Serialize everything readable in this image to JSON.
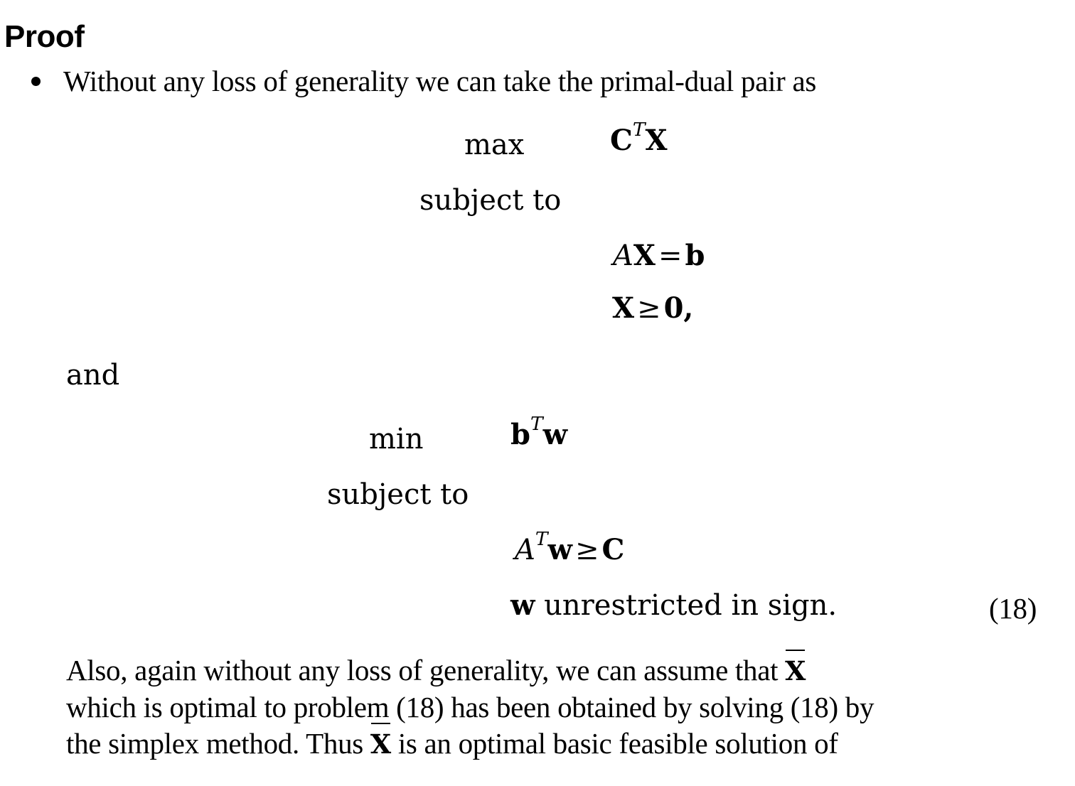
{
  "document": {
    "heading": "Proof",
    "bullet": {
      "marker": "bullet-dot",
      "text": "Without any loss of generality we can take the primal-dual pair as"
    },
    "primal": {
      "objective_op": "max",
      "objective_expr_lead": "C",
      "objective_expr_sup": "T",
      "objective_expr_tail": "X",
      "subject_to": "subject to",
      "constraint_equality": {
        "matrix": "A",
        "variable": "X",
        "relation": "=",
        "rhs": "b"
      },
      "constraint_nonneg": {
        "variable": "X",
        "relation": "≥",
        "rhs": "0",
        "trailing_punctuation": ","
      }
    },
    "connector": "and",
    "dual": {
      "objective_op": "min",
      "objective_expr_lead": "b",
      "objective_expr_sup": "T",
      "objective_expr_tail": "w",
      "subject_to": "subject to",
      "constraint_inequality": {
        "matrix": "A",
        "matrix_sup": "T",
        "variable": "w",
        "relation": "≥",
        "rhs": "C"
      },
      "unrestricted": {
        "variable": "w",
        "text": " unrestricted in sign."
      }
    },
    "equation_number": "(18)",
    "closing_paragraph": {
      "line1_pre": "Also, again without any loss of generality, we can assume that ",
      "line1_xbar": "X̄",
      "line2": "which is optimal to problem (18) has been obtained by solving (18) by",
      "line3_pre": "the simplex method. Thus ",
      "line3_xbar": "X̄",
      "line3_post": " is an optimal basic feasible solution of"
    }
  },
  "colors": {
    "background": "#ffffff",
    "text": "#000000"
  }
}
